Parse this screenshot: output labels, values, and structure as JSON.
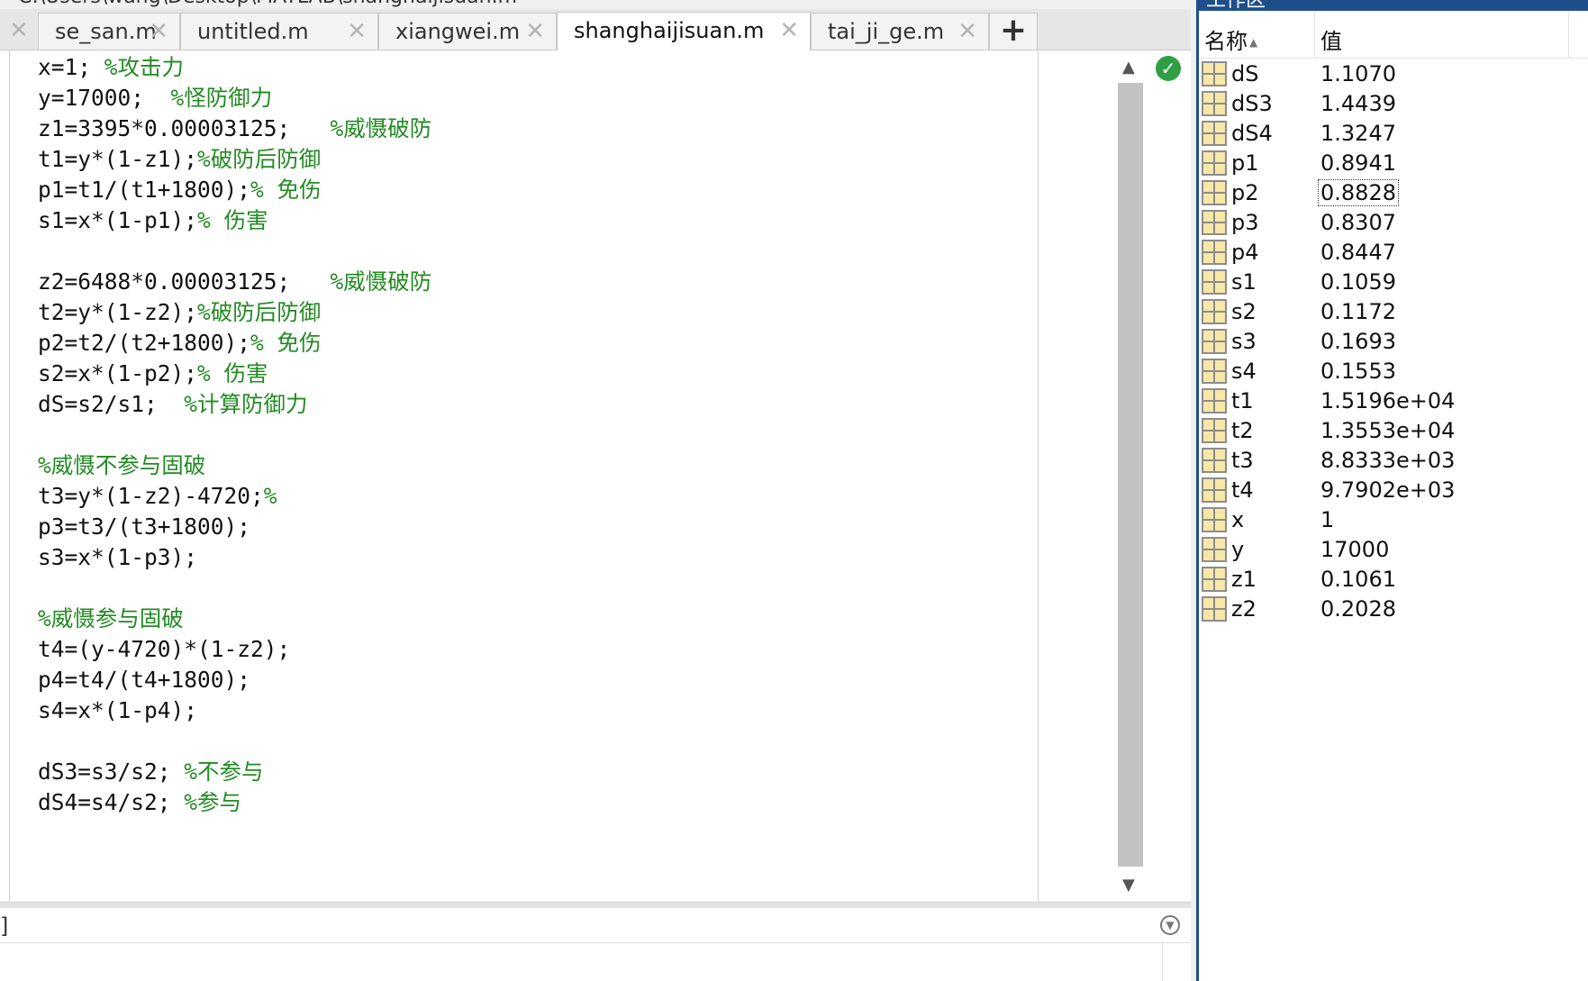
{
  "window": {
    "path_text": "C:\\Users\\wang\\Desktop\\MATLAB\\shanghaijisuan.m",
    "workspace_title": "工作区"
  },
  "tabs": [
    {
      "label": "se_san.m"
    },
    {
      "label": "untitled.m"
    },
    {
      "label": "xiangwei.m"
    },
    {
      "label": "shanghaijisuan.m",
      "active": true
    },
    {
      "label": "tai_ji_ge.m"
    }
  ],
  "icons": {
    "tab_close": "close-icon",
    "add_tab": "plus-icon",
    "status": "check-circle-icon",
    "scroll_up": "arrow-up-icon",
    "scroll_down": "arrow-down-icon",
    "cmd_toggle": "chevron-down-circle-icon",
    "variable": "matrix-grid-icon"
  },
  "glyphs": {
    "close": "✕",
    "plus": "+",
    "check": "✓",
    "up": "▲",
    "down": "▼",
    "chevron": "▼"
  },
  "colors": {
    "comment": "#228B22",
    "accent": "#1e4f8a",
    "status_ok": "#2ea043"
  },
  "editor": {
    "lines": [
      {
        "code": "x=1; ",
        "comment": "%攻击力"
      },
      {
        "code": "y=17000;  ",
        "comment": "%怪防御力"
      },
      {
        "code": "z1=3395*0.00003125;   ",
        "comment": "%威慑破防"
      },
      {
        "code": "t1=y*(1-z1);",
        "comment": "%破防后防御"
      },
      {
        "code": "p1=t1/(t1+1800);",
        "comment": "% 免伤"
      },
      {
        "code": "s1=x*(1-p1);",
        "comment": "% 伤害"
      },
      {
        "code": "",
        "comment": ""
      },
      {
        "code": "z2=6488*0.00003125;   ",
        "comment": "%威慑破防"
      },
      {
        "code": "t2=y*(1-z2);",
        "comment": "%破防后防御"
      },
      {
        "code": "p2=t2/(t2+1800);",
        "comment": "% 免伤"
      },
      {
        "code": "s2=x*(1-p2);",
        "comment": "% 伤害"
      },
      {
        "code": "dS=s2/s1;  ",
        "comment": "%计算防御力"
      },
      {
        "code": "",
        "comment": ""
      },
      {
        "code": "",
        "comment": "%威慑不参与固破"
      },
      {
        "code": "t3=y*(1-z2)-4720;",
        "comment": "%"
      },
      {
        "code": "p3=t3/(t3+1800);",
        "comment": ""
      },
      {
        "code": "s3=x*(1-p3);",
        "comment": ""
      },
      {
        "code": "",
        "comment": ""
      },
      {
        "code": "",
        "comment": "%威慑参与固破"
      },
      {
        "code": "t4=(y-4720)*(1-z2);",
        "comment": ""
      },
      {
        "code": "p4=t4/(t4+1800);",
        "comment": ""
      },
      {
        "code": "s4=x*(1-p4);",
        "comment": ""
      },
      {
        "code": "",
        "comment": ""
      },
      {
        "code": "dS3=s3/s2; ",
        "comment": "%不参与"
      },
      {
        "code": "dS4=s4/s2; ",
        "comment": "%参与"
      }
    ]
  },
  "command_window": {
    "prompt_fragment": "]"
  },
  "workspace": {
    "header": {
      "name": "名称",
      "sort_indicator": "▲",
      "value": "值"
    },
    "variables": [
      {
        "name": "dS",
        "value": "1.1070"
      },
      {
        "name": "dS3",
        "value": "1.4439"
      },
      {
        "name": "dS4",
        "value": "1.3247"
      },
      {
        "name": "p1",
        "value": "0.8941"
      },
      {
        "name": "p2",
        "value": "0.8828",
        "focused": true
      },
      {
        "name": "p3",
        "value": "0.8307"
      },
      {
        "name": "p4",
        "value": "0.8447"
      },
      {
        "name": "s1",
        "value": "0.1059"
      },
      {
        "name": "s2",
        "value": "0.1172"
      },
      {
        "name": "s3",
        "value": "0.1693"
      },
      {
        "name": "s4",
        "value": "0.1553"
      },
      {
        "name": "t1",
        "value": "1.5196e+04"
      },
      {
        "name": "t2",
        "value": "1.3553e+04"
      },
      {
        "name": "t3",
        "value": "8.8333e+03"
      },
      {
        "name": "t4",
        "value": "9.7902e+03"
      },
      {
        "name": "x",
        "value": "1"
      },
      {
        "name": "y",
        "value": "17000"
      },
      {
        "name": "z1",
        "value": "0.1061"
      },
      {
        "name": "z2",
        "value": "0.2028"
      }
    ]
  }
}
